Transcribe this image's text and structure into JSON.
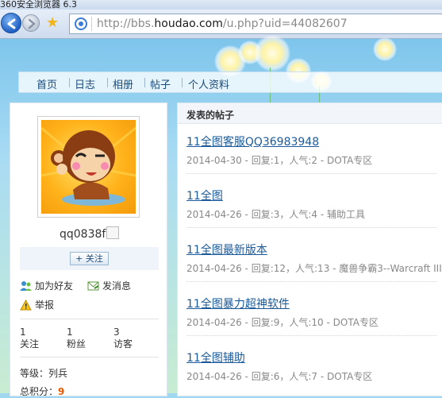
{
  "window": {
    "title": "360安全浏览器 6.3"
  },
  "browser": {
    "url_prefix": "http://bbs.",
    "url_domain": "houdao.com",
    "url_path": "/u.php?uid=44082607"
  },
  "nav": {
    "items": [
      "首页",
      "日志",
      "相册",
      "帖子",
      "个人资料"
    ]
  },
  "profile": {
    "username": "qq0838f",
    "follow_label": "+ 关注",
    "add_friend": "加为好友",
    "send_message": "发消息",
    "report": "举报",
    "stats": [
      {
        "value": "1",
        "label": "关注"
      },
      {
        "value": "1",
        "label": "粉丝"
      },
      {
        "value": "3",
        "label": "访客"
      }
    ],
    "rank_label": "等级：",
    "rank_value": "列兵",
    "points_label": "总积分：",
    "points_value": "9"
  },
  "posts": {
    "heading": "发表的帖子",
    "items": [
      {
        "title": "11全图客服QQ36983948",
        "meta": "2014-04-30 - 回复:1，人气:2 - DOTA专区"
      },
      {
        "title": "11全图",
        "meta": "2014-04-26 - 回复:3，人气:4 - 辅助工具"
      },
      {
        "title": "11全图最新版本",
        "meta": "2014-04-26 - 回复:12，人气:13 - 魔兽争霸3--Warcraft III"
      },
      {
        "title": "11全图暴力超神软件",
        "meta": "2014-04-26 - 回复:9，人气:10 - DOTA专区"
      },
      {
        "title": "11全图辅助",
        "meta": "2014-04-26 - 回复:6，人气:7 - DOTA专区"
      }
    ]
  }
}
